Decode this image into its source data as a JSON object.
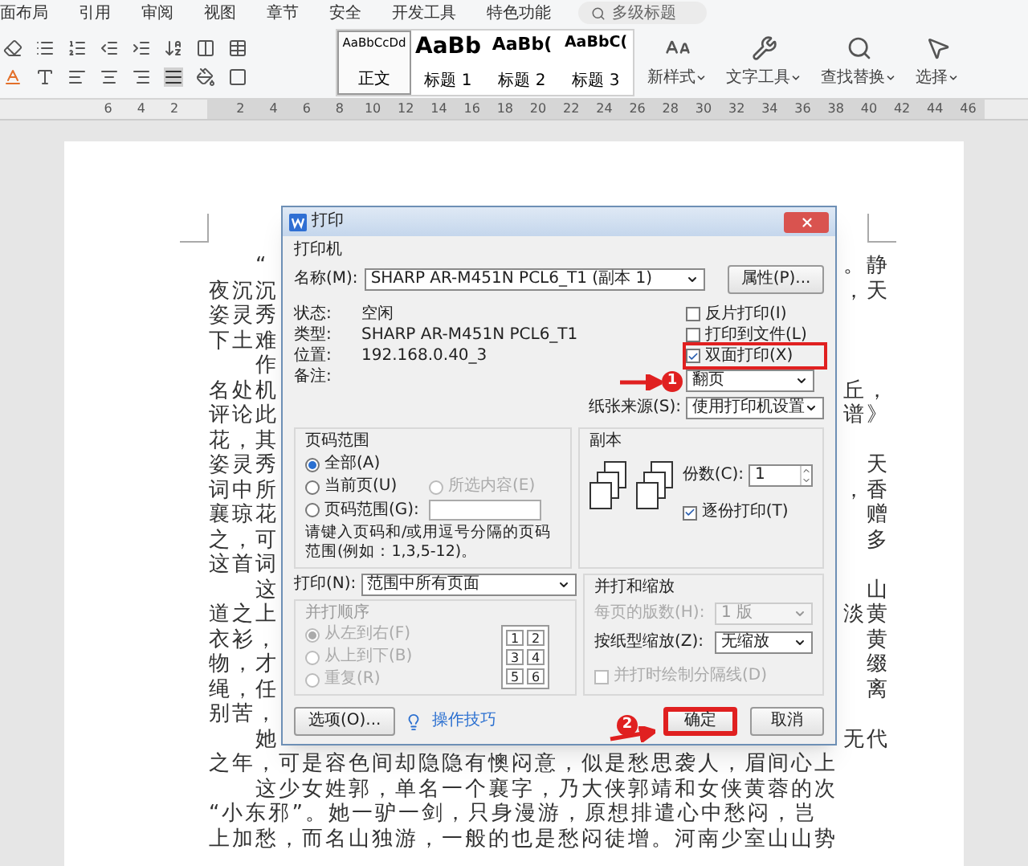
{
  "menu_tabs": [
    "面布局",
    "引用",
    "审阅",
    "视图",
    "章节",
    "安全",
    "开发工具",
    "特色功能"
  ],
  "search": {
    "placeholder": "多级标题"
  },
  "styles": [
    {
      "sample": "AaBbCcDd",
      "label": "正文",
      "selected": true
    },
    {
      "sample": "AaBb",
      "label": "标题 1",
      "selected": false
    },
    {
      "sample": "AaBb(",
      "label": "标题 2",
      "selected": false
    },
    {
      "sample": "AaBbC(",
      "label": "标题 3",
      "selected": false
    }
  ],
  "tools": [
    {
      "label": "新样式"
    },
    {
      "label": "文字工具"
    },
    {
      "label": "查找替换"
    },
    {
      "label": "选择"
    }
  ],
  "ruler": {
    "left_labels": [
      "6",
      "4",
      "2"
    ],
    "labels": [
      "2",
      "4",
      "6",
      "8",
      "10",
      "12",
      "14",
      "16",
      "18",
      "20",
      "22",
      "24",
      "26",
      "28",
      "30",
      "32",
      "34",
      "36",
      "38",
      "40",
      "42",
      "44",
      "46"
    ]
  },
  "document": {
    "rows": [
      {
        "left": "“",
        "right": "。静",
        "indent": true
      },
      {
        "left": "夜沉沉",
        "right": "，天",
        "indent": false
      },
      {
        "left": "姿灵秀",
        "indent": false
      },
      {
        "left": "下土难",
        "indent": false
      },
      {
        "left": "作",
        "indent": true
      },
      {
        "left": "名处机",
        "right": "丘，",
        "indent": false
      },
      {
        "left": "评论此",
        "right": "谱》",
        "indent": false
      },
      {
        "left": "花，其",
        "indent": false
      },
      {
        "left": "姿灵秀",
        "right": "天",
        "indent": false
      },
      {
        "left": "词中所",
        "right": "，香",
        "indent": false
      },
      {
        "left": "襄琼花",
        "right": "赠",
        "indent": false
      },
      {
        "left": "之，可",
        "right": "多",
        "indent": false
      },
      {
        "left": "这首词",
        "indent": false
      },
      {
        "left": "这",
        "right": "山",
        "indent": true
      },
      {
        "left": "道之上",
        "right": "淡黄",
        "indent": false
      },
      {
        "left": "衣衫，",
        "right": "黄",
        "indent": false
      },
      {
        "left": "物，才",
        "right": "缀",
        "indent": false
      },
      {
        "left": "绳，任",
        "right": "离",
        "indent": false
      },
      {
        "left": "别苦，",
        "indent": false
      },
      {
        "left": "她",
        "right": "无代",
        "indent": true
      }
    ],
    "lines": [
      {
        "text": "之年，可是容色间却隐隐有懊闷意，似是愁思袭人，眉间心上",
        "indent": false
      },
      {
        "text": "这少女姓郭，单名一个襄字，乃大侠郭靖和女侠黄蓉的次",
        "indent": true
      },
      {
        "text": "“小东邪”。她一驴一剑，只身漫游，原想排遣心中愁闷，岂",
        "indent": false
      },
      {
        "text": "上加愁，而名山独游，一般的也是愁闷徒增。河南少室山山势",
        "indent": false
      }
    ]
  },
  "dialog": {
    "title": "打印",
    "printer": {
      "group": "打印机",
      "name_label": "名称(M):",
      "name_value": "SHARP AR-M451N PCL6_T1 (副本 1)",
      "properties_button": "属性(P)...",
      "info": [
        {
          "label": "状态:",
          "value": "空闲"
        },
        {
          "label": "类型:",
          "value": "SHARP AR-M451N PCL6_T1"
        },
        {
          "label": "位置:",
          "value": "192.168.0.40_3"
        },
        {
          "label": "备注:"
        }
      ],
      "options": [
        {
          "label": "反片打印(I)",
          "checked": false,
          "highlighted": false
        },
        {
          "label": "打印到文件(L)",
          "checked": false,
          "highlighted": false
        },
        {
          "label": "双面打印(X)",
          "checked": true,
          "highlighted": true
        }
      ],
      "duplex_select": "翻页",
      "paper_source": {
        "label": "纸张来源(S):",
        "value": "使用打印机设置"
      }
    },
    "page_range": {
      "title": "页码范围",
      "options": [
        {
          "label": "全部(A)",
          "selected": true,
          "disabled": false
        },
        {
          "label": "当前页(U)",
          "selected": false,
          "disabled": false
        },
        {
          "label": "所选内容(E)",
          "selected": false,
          "disabled": true
        },
        {
          "label": "页码范围(G):",
          "selected": false,
          "disabled": false
        }
      ],
      "hint": "请键入页码和/或用逗号分隔的页码范围(例如：1,3,5-12)。"
    },
    "copies": {
      "title": "副本",
      "count_label": "份数(C):",
      "count": "1",
      "collate": {
        "label": "逐份打印(T)",
        "checked": true
      }
    },
    "print_select": {
      "label": "打印(N):",
      "value": "范围中所有页面"
    },
    "order": {
      "title": "并打顺序",
      "disabled": true,
      "options": [
        {
          "label": "从左到右(F)",
          "selected": true
        },
        {
          "label": "从上到下(B)",
          "selected": false
        },
        {
          "label": "重复(R)",
          "selected": false
        }
      ],
      "grid_labels": [
        "1",
        "2",
        "3",
        "4",
        "5",
        "6"
      ]
    },
    "scaling": {
      "title": "并打和缩放",
      "fields": [
        {
          "label": "每页的版数(H):",
          "value": "1 版",
          "disabled": true
        },
        {
          "label": "按纸型缩放(Z):",
          "value": "无缩放",
          "disabled": false
        }
      ],
      "divider_option": {
        "label": "并打时绘制分隔线(D)",
        "checked": false,
        "disabled": true
      }
    },
    "options_button": "选项(O)...",
    "tips_link": "操作技巧",
    "buttons": [
      {
        "label": "确定",
        "highlighted": true
      },
      {
        "label": "取消",
        "highlighted": false
      }
    ]
  },
  "annotations": [
    {
      "label": "1"
    },
    {
      "label": "2"
    }
  ]
}
